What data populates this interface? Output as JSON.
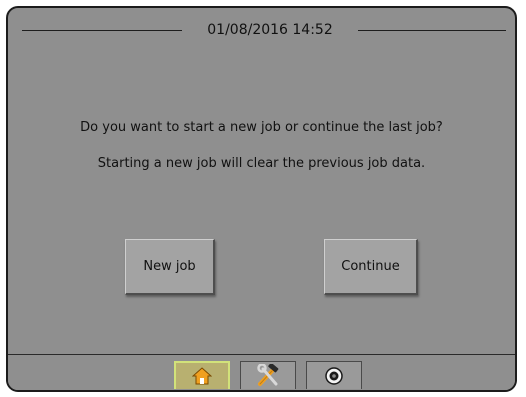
{
  "header": {
    "datetime": "01/08/2016 14:52"
  },
  "dialog": {
    "question": "Do you want to start a new job or continue the last job?",
    "note": "Starting a new job will clear the previous job data."
  },
  "buttons": {
    "new_job": "New job",
    "continue": "Continue"
  },
  "tabs": [
    {
      "icon": "home-icon",
      "active": true
    },
    {
      "icon": "tools-icon",
      "active": false
    },
    {
      "icon": "camera-icon",
      "active": false
    }
  ],
  "colors": {
    "screen_bg": "#8f8f8f",
    "button_bg": "#a3a3a3",
    "active_tab_accent": "#d2e27a",
    "home_icon": "#f0a020"
  }
}
